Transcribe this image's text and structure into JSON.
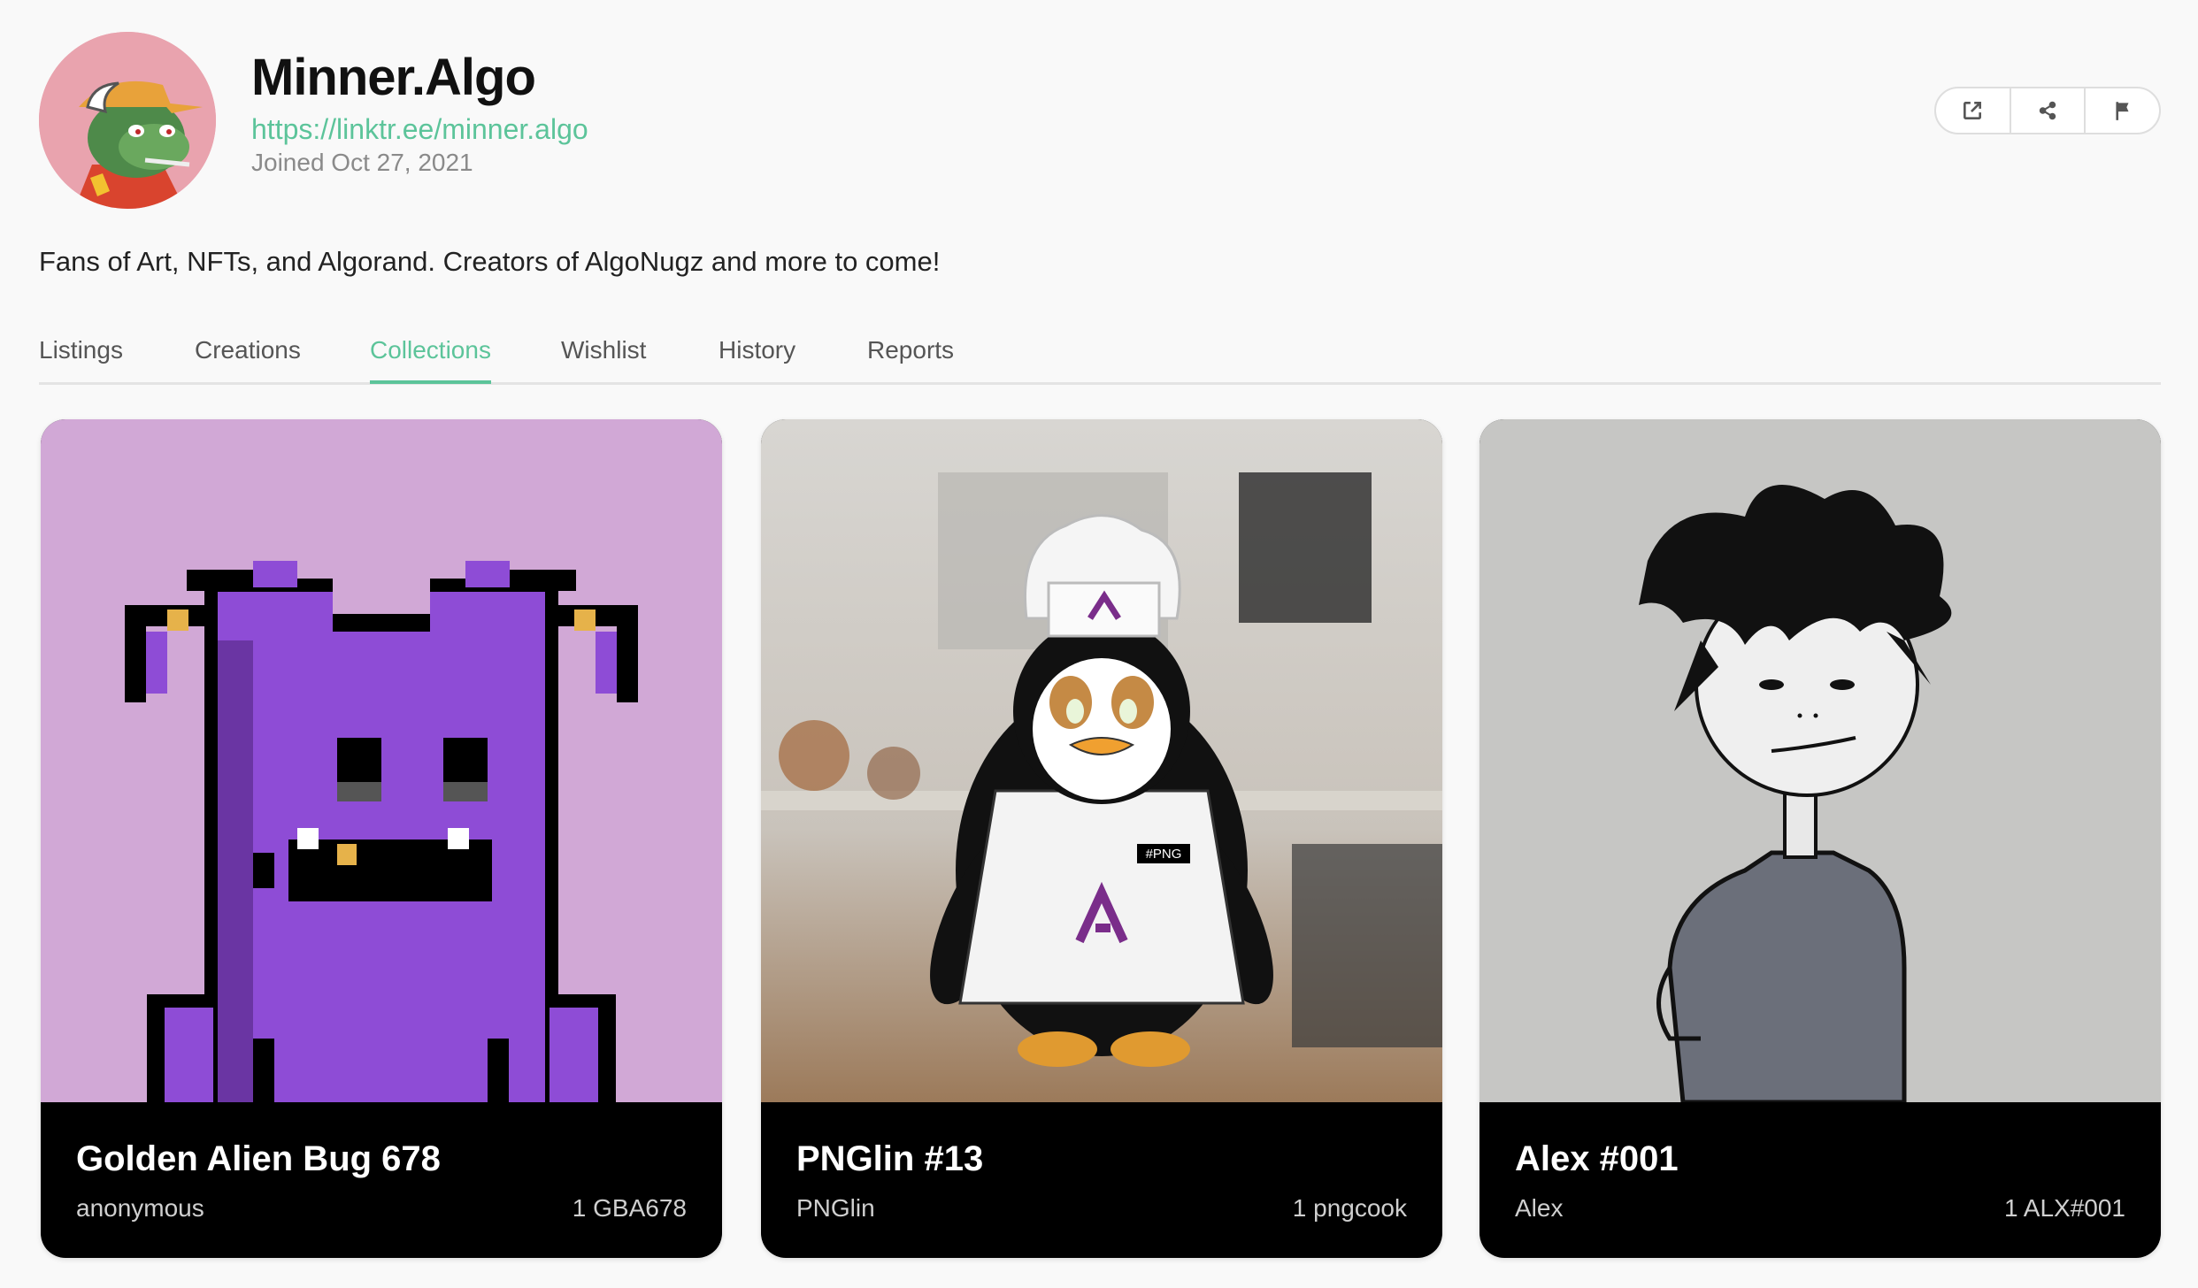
{
  "profile": {
    "name": "Minner.Algo",
    "link": "https://linktr.ee/minner.algo",
    "joined": "Joined Oct 27, 2021",
    "bio": "Fans of Art, NFTs, and Algorand. Creators of AlgoNugz and more to come!"
  },
  "actions": [
    {
      "icon": "external-link-icon"
    },
    {
      "icon": "share-icon"
    },
    {
      "icon": "flag-icon"
    }
  ],
  "tabs": [
    {
      "label": "Listings"
    },
    {
      "label": "Creations"
    },
    {
      "label": "Collections",
      "active": true
    },
    {
      "label": "Wishlist"
    },
    {
      "label": "History"
    },
    {
      "label": "Reports"
    }
  ],
  "colors": {
    "accent": "#5cc49a",
    "background": "#f9f9f9",
    "card_footer": "#000000"
  },
  "cards": [
    {
      "title": "Golden Alien Bug 678",
      "creator": "anonymous",
      "unit": "1 GBA678"
    },
    {
      "title": "PNGlin #13",
      "creator": "PNGlin",
      "unit": "1 pngcook"
    },
    {
      "title": "Alex #001",
      "creator": "Alex",
      "unit": "1 ALX#001"
    }
  ]
}
